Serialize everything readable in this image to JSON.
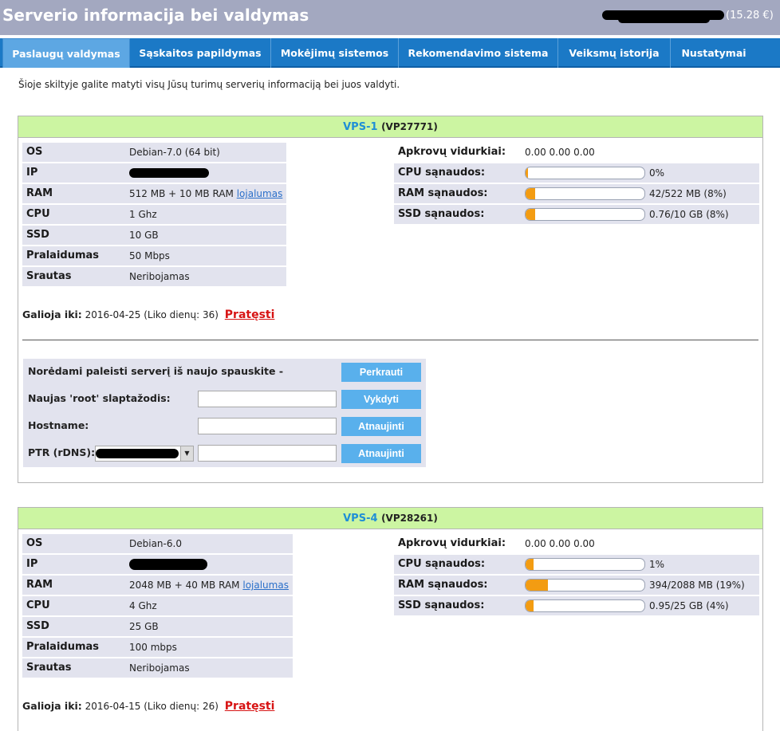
{
  "header": {
    "title": "Serverio informacija bei valdymas",
    "balance": "(15.28 €)"
  },
  "tabs": [
    {
      "label": "Paslaugų valdymas"
    },
    {
      "label": "Sąskaitos papildymas"
    },
    {
      "label": "Mokėjimų sistemos"
    },
    {
      "label": "Rekomendavimo sistema"
    },
    {
      "label": "Veiksmų istorija"
    },
    {
      "label": "Nustatymai"
    }
  ],
  "intro": "Šioje skiltyje galite matyti visų Jūsų turimų serverių informaciją bei juos valdyti.",
  "labels": {
    "os": "OS",
    "ip": "IP",
    "ram": "RAM",
    "cpu": "CPU",
    "ssd": "SSD",
    "bandwidth": "Pralaidumas",
    "traffic": "Srautas",
    "load_avg": "Apkrovų vidurkiai:",
    "cpu_usage": "CPU sąnaudos:",
    "ram_usage": "RAM sąnaudos:",
    "ssd_usage": "SSD sąnaudos:",
    "valid_until": "Galioja iki:",
    "extend": "Pratęsti",
    "loyalty": "lojalumas"
  },
  "servers": [
    {
      "name": "VPS-1",
      "code": "(VP27771)",
      "os": "Debian-7.0 (64 bit)",
      "ram": "512 MB + 10 MB RAM",
      "cpu": "1 Ghz",
      "ssd": "10 GB",
      "bandwidth": "50 Mbps",
      "traffic": "Neribojamas",
      "load_avg": "0.00 0.00 0.00",
      "cpu_usage": {
        "value": "0%",
        "fraction": 0.0
      },
      "ram_usage": {
        "value": "42/522 MB (8%)",
        "fraction": 0.08
      },
      "ssd_usage": {
        "value": "0.76/10 GB (8%)",
        "fraction": 0.08
      },
      "valid_until": "2016-04-25",
      "days_left": "(Liko dienų: 36)"
    },
    {
      "name": "VPS-4",
      "code": "(VP28261)",
      "os": "Debian-6.0",
      "ram": "2048 MB + 40 MB RAM",
      "cpu": "4 Ghz",
      "ssd": "25 GB",
      "bandwidth": "100 mbps",
      "traffic": "Neribojamas",
      "load_avg": "0.00 0.00 0.00",
      "cpu_usage": {
        "value": "1%",
        "fraction": 0.01
      },
      "ram_usage": {
        "value": "394/2088 MB (19%)",
        "fraction": 0.19
      },
      "ssd_usage": {
        "value": "0.95/25 GB (4%)",
        "fraction": 0.04
      },
      "valid_until": "2016-04-15",
      "days_left": "(Liko dienų: 26)"
    }
  ],
  "actions": {
    "reboot_label": "Norėdami paleisti serverį iš naujo spauskite -",
    "reboot_btn": "Perkrauti",
    "root_label": "Naujas 'root' slaptažodis:",
    "root_btn": "Vykdyti",
    "hostname_label": "Hostname:",
    "hostname_btn": "Atnaujinti",
    "ptr_label": "PTR (rDNS):",
    "ptr_btn": "Atnaujinti"
  },
  "colors": {
    "header_bg": "#a3a8c0",
    "tab_bar": "#1b79c6",
    "tab_active": "#5da7e3",
    "vps_head": "#ccf5a2",
    "row_shade": "#e2e3ee",
    "bar_fill": "#f39c12",
    "extend_link": "#d71414",
    "button": "#59b0ec"
  }
}
